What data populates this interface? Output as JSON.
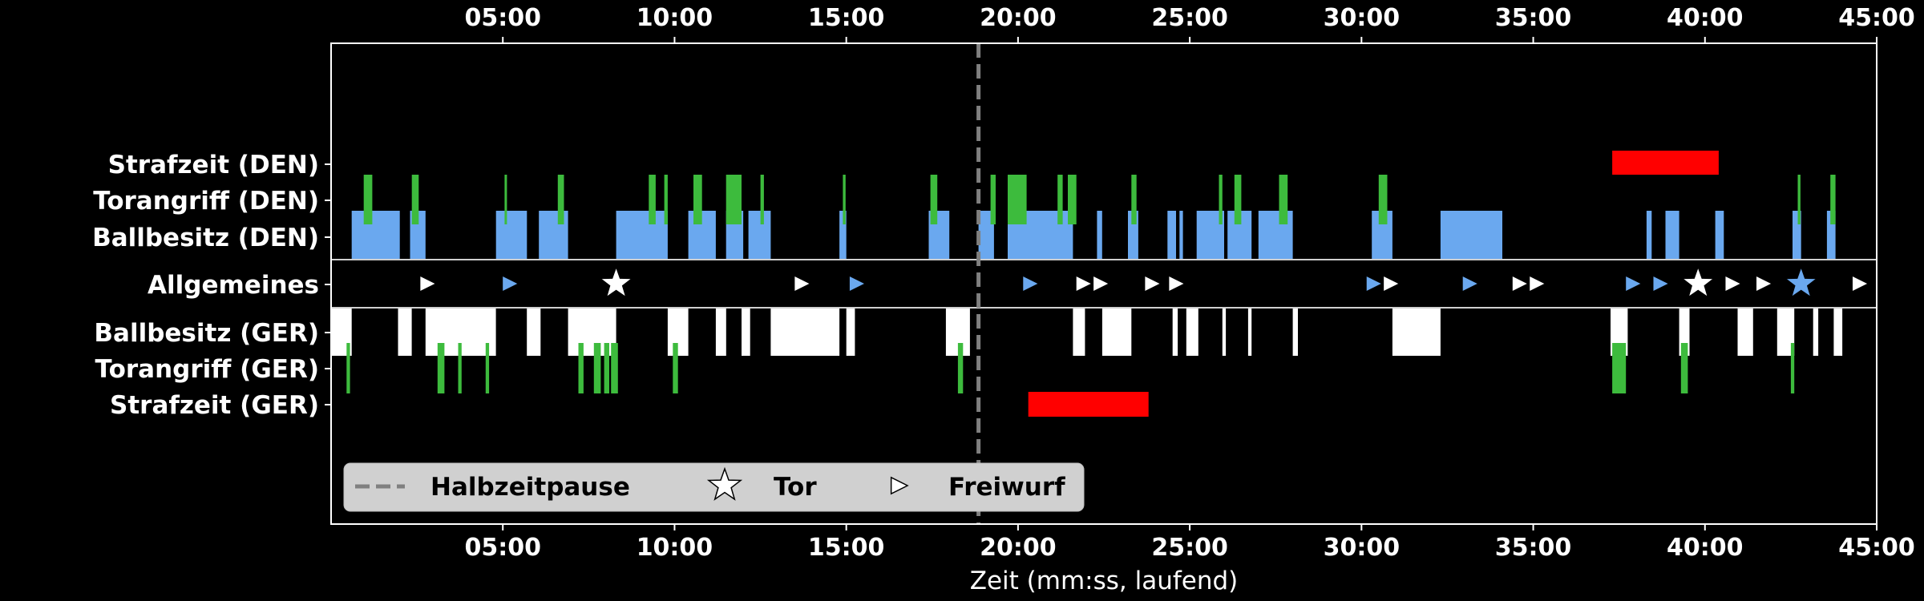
{
  "chart_data": {
    "type": "timeline",
    "title": "",
    "xlabel": "Zeit (mm:ss, laufend)",
    "xlim": [
      0,
      45
    ],
    "x_ticks": [
      5,
      10,
      15,
      20,
      25,
      30,
      35,
      40,
      45
    ],
    "x_tick_labels": [
      "05:00",
      "10:00",
      "15:00",
      "20:00",
      "25:00",
      "30:00",
      "35:00",
      "40:00",
      "45:00"
    ],
    "rows": [
      {
        "key": "strafzeit_den",
        "label": "Strafzeit (DEN)"
      },
      {
        "key": "torangriff_den",
        "label": "Torangriff (DEN)"
      },
      {
        "key": "ballbesitz_den",
        "label": "Ballbesitz (DEN)"
      },
      {
        "key": "allgemeines",
        "label": "Allgemeines"
      },
      {
        "key": "ballbesitz_ger",
        "label": "Ballbesitz (GER)"
      },
      {
        "key": "torangriff_ger",
        "label": "Torangriff (GER)"
      },
      {
        "key": "strafzeit_ger",
        "label": "Strafzeit (GER)"
      }
    ],
    "colors": {
      "den": "#6aa8ef",
      "ger": "#ffffff",
      "attack": "#3dbb3d",
      "penalty": "#ff0000",
      "halftime": "#808080",
      "background": "#000000"
    },
    "halftime_min": 18.85,
    "ballbesitz_den": [
      [
        0.6,
        2.0
      ],
      [
        2.3,
        2.75
      ],
      [
        4.8,
        5.7
      ],
      [
        6.05,
        6.9
      ],
      [
        8.3,
        9.8
      ],
      [
        10.4,
        11.2
      ],
      [
        11.5,
        12.0
      ],
      [
        12.15,
        12.8
      ],
      [
        14.8,
        15.0
      ],
      [
        17.4,
        18.0
      ],
      [
        18.85,
        19.3
      ],
      [
        19.7,
        21.6
      ],
      [
        22.3,
        22.45
      ],
      [
        23.2,
        23.5
      ],
      [
        24.35,
        24.6
      ],
      [
        24.7,
        24.8
      ],
      [
        25.2,
        26.0
      ],
      [
        26.1,
        26.8
      ],
      [
        27.0,
        28.0
      ],
      [
        30.3,
        30.9
      ],
      [
        32.3,
        34.1
      ],
      [
        38.3,
        38.45
      ],
      [
        38.85,
        39.25
      ],
      [
        40.3,
        40.55
      ],
      [
        42.55,
        42.8
      ],
      [
        43.55,
        43.8
      ]
    ],
    "torangriff_den": [
      [
        0.95,
        1.2
      ],
      [
        2.35,
        2.55
      ],
      [
        5.05,
        5.12
      ],
      [
        6.6,
        6.78
      ],
      [
        9.25,
        9.45
      ],
      [
        9.7,
        9.8
      ],
      [
        10.55,
        10.8
      ],
      [
        11.5,
        11.95
      ],
      [
        12.5,
        12.6
      ],
      [
        14.9,
        14.98
      ],
      [
        17.45,
        17.65
      ],
      [
        19.2,
        19.35
      ],
      [
        19.7,
        20.25
      ],
      [
        21.15,
        21.3
      ],
      [
        21.45,
        21.7
      ],
      [
        23.3,
        23.45
      ],
      [
        25.85,
        25.95
      ],
      [
        26.3,
        26.5
      ],
      [
        27.6,
        27.85
      ],
      [
        30.5,
        30.75
      ],
      [
        42.7,
        42.78
      ],
      [
        43.65,
        43.8
      ]
    ],
    "strafzeit_den": [
      [
        37.3,
        40.4
      ]
    ],
    "ballbesitz_ger": [
      [
        0.0,
        0.6
      ],
      [
        1.95,
        2.35
      ],
      [
        2.75,
        4.8
      ],
      [
        5.7,
        6.1
      ],
      [
        6.9,
        8.3
      ],
      [
        9.8,
        10.4
      ],
      [
        11.2,
        11.5
      ],
      [
        11.95,
        12.2
      ],
      [
        12.8,
        14.8
      ],
      [
        15.0,
        15.25
      ],
      [
        17.9,
        18.6
      ],
      [
        21.6,
        21.95
      ],
      [
        22.45,
        23.3
      ],
      [
        24.5,
        24.65
      ],
      [
        24.9,
        25.25
      ],
      [
        25.95,
        26.05
      ],
      [
        26.7,
        26.8
      ],
      [
        28.0,
        28.15
      ],
      [
        30.9,
        32.3
      ],
      [
        37.25,
        37.75
      ],
      [
        39.25,
        39.55
      ],
      [
        40.95,
        41.4
      ],
      [
        42.1,
        42.6
      ],
      [
        43.15,
        43.3
      ],
      [
        43.75,
        44.0
      ]
    ],
    "torangriff_ger": [
      [
        0.45,
        0.55
      ],
      [
        3.1,
        3.3
      ],
      [
        3.7,
        3.8
      ],
      [
        4.5,
        4.6
      ],
      [
        7.2,
        7.35
      ],
      [
        7.65,
        7.85
      ],
      [
        7.95,
        8.1
      ],
      [
        8.15,
        8.35
      ],
      [
        9.95,
        10.1
      ],
      [
        18.25,
        18.4
      ],
      [
        37.3,
        37.7
      ],
      [
        39.3,
        39.5
      ],
      [
        42.5,
        42.6
      ]
    ],
    "strafzeit_ger": [
      [
        20.3,
        23.8
      ]
    ],
    "events": [
      {
        "t": 2.8,
        "kind": "freiwurf",
        "team": "ger"
      },
      {
        "t": 5.2,
        "kind": "freiwurf",
        "team": "den"
      },
      {
        "t": 8.3,
        "kind": "tor",
        "team": "ger"
      },
      {
        "t": 13.7,
        "kind": "freiwurf",
        "team": "ger"
      },
      {
        "t": 15.3,
        "kind": "freiwurf",
        "team": "den"
      },
      {
        "t": 20.35,
        "kind": "freiwurf",
        "team": "den"
      },
      {
        "t": 21.9,
        "kind": "freiwurf",
        "team": "ger"
      },
      {
        "t": 22.4,
        "kind": "freiwurf",
        "team": "ger"
      },
      {
        "t": 23.9,
        "kind": "freiwurf",
        "team": "ger"
      },
      {
        "t": 24.6,
        "kind": "freiwurf",
        "team": "ger"
      },
      {
        "t": 30.35,
        "kind": "freiwurf",
        "team": "den"
      },
      {
        "t": 30.85,
        "kind": "freiwurf",
        "team": "ger"
      },
      {
        "t": 33.15,
        "kind": "freiwurf",
        "team": "den"
      },
      {
        "t": 34.6,
        "kind": "freiwurf",
        "team": "ger"
      },
      {
        "t": 35.1,
        "kind": "freiwurf",
        "team": "ger"
      },
      {
        "t": 37.9,
        "kind": "freiwurf",
        "team": "den"
      },
      {
        "t": 38.7,
        "kind": "freiwurf",
        "team": "den"
      },
      {
        "t": 39.8,
        "kind": "tor",
        "team": "ger"
      },
      {
        "t": 40.8,
        "kind": "freiwurf",
        "team": "ger"
      },
      {
        "t": 41.7,
        "kind": "freiwurf",
        "team": "ger"
      },
      {
        "t": 42.8,
        "kind": "tor",
        "team": "den"
      },
      {
        "t": 44.5,
        "kind": "freiwurf",
        "team": "ger"
      }
    ],
    "legend": {
      "position": "lower-left",
      "items": [
        {
          "kind": "halftime",
          "label": "Halbzeitpause"
        },
        {
          "kind": "tor",
          "label": "Tor"
        },
        {
          "kind": "freiwurf",
          "label": "Freiwurf"
        }
      ]
    }
  }
}
